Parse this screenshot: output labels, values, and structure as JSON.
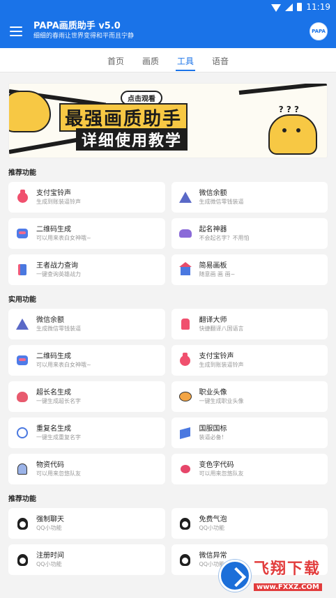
{
  "status_bar": {
    "time": "11:19"
  },
  "app_bar": {
    "title": "PAPA画质助手 v5.0",
    "subtitle": "细细的春雨让世界变得和平而且宁静",
    "avatar_text": "PAPA"
  },
  "tabs": [
    {
      "label": "首页",
      "active": false
    },
    {
      "label": "画质",
      "active": false
    },
    {
      "label": "工具",
      "active": true
    },
    {
      "label": "语音",
      "active": false
    }
  ],
  "banner": {
    "tag": "点击观看",
    "headline": "最强画质助手",
    "subheadline": "详细使用教学",
    "question_marks": "? ? ?"
  },
  "sections": [
    {
      "title": "推荐功能",
      "items": [
        {
          "title": "支付宝铃声",
          "desc": "生成到账装逼铃声",
          "icon": "money-bag-icon"
        },
        {
          "title": "微信余额",
          "desc": "生成微信零钱装逼",
          "icon": "wizard-hat-icon"
        },
        {
          "title": "二维码生成",
          "desc": "可以用来表白女神哦~",
          "icon": "monster-icon"
        },
        {
          "title": "起名神器",
          "desc": "不会起名字？不用怕",
          "icon": "bat-icon"
        },
        {
          "title": "王者战力查询",
          "desc": "一键查询英雄战力",
          "icon": "spellbook-icon"
        },
        {
          "title": "简易画板",
          "desc": "随意画 画 画~",
          "icon": "haunted-house-icon"
        }
      ]
    },
    {
      "title": "实用功能",
      "items": [
        {
          "title": "微信余额",
          "desc": "生成微信零钱装逼",
          "icon": "wizard-hat-icon"
        },
        {
          "title": "翻译大师",
          "desc": "快捷翻译八国语言",
          "icon": "potion-bottle-icon"
        },
        {
          "title": "二维码生成",
          "desc": "可以用来表白女神哦~",
          "icon": "monster-icon"
        },
        {
          "title": "支付宝铃声",
          "desc": "生成到账装逼铃声",
          "icon": "money-bag-icon"
        },
        {
          "title": "超长名生成",
          "desc": "一键生成超长名字",
          "icon": "skull-icon"
        },
        {
          "title": "职业头像",
          "desc": "一键生成职业头像",
          "icon": "pumpkin-icon"
        },
        {
          "title": "重复名生成",
          "desc": "一键生成重复名字",
          "icon": "spider-web-icon"
        },
        {
          "title": "国服国标",
          "desc": "装逼必备！",
          "icon": "flag-icon"
        },
        {
          "title": "物资代码",
          "desc": "可以用来忽悠队友",
          "icon": "ghost-icon"
        },
        {
          "title": "变色字代码",
          "desc": "可以用来忽悠队友",
          "icon": "spider-icon"
        }
      ]
    },
    {
      "title": "推荐功能",
      "items": [
        {
          "title": "强制聊天",
          "desc": "QQ小功能",
          "icon": "penguin-icon"
        },
        {
          "title": "免费气泡",
          "desc": "QQ小功能",
          "icon": "penguin-icon"
        },
        {
          "title": "注册时间",
          "desc": "QQ小功能",
          "icon": "penguin-icon"
        },
        {
          "title": "微信异常",
          "desc": "QQ小功能",
          "icon": "penguin-icon"
        }
      ]
    }
  ],
  "watermark": {
    "name": "飞翔下载",
    "url": "www.FXXZ.COM"
  }
}
